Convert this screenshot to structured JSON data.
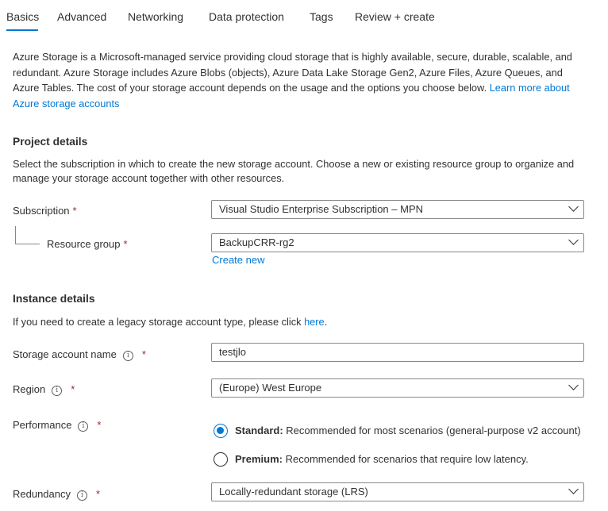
{
  "tabs": [
    {
      "label": "Basics",
      "active": true
    },
    {
      "label": "Advanced",
      "active": false
    },
    {
      "label": "Networking",
      "active": false
    },
    {
      "label": "Data protection",
      "active": false
    },
    {
      "label": "Tags",
      "active": false
    },
    {
      "label": "Review + create",
      "active": false
    }
  ],
  "intro": {
    "text": "Azure Storage is a Microsoft-managed service providing cloud storage that is highly available, secure, durable, scalable, and redundant. Azure Storage includes Azure Blobs (objects), Azure Data Lake Storage Gen2, Azure Files, Azure Queues, and Azure Tables. The cost of your storage account depends on the usage and the options you choose below. ",
    "link": "Learn more about Azure storage accounts"
  },
  "project": {
    "title": "Project details",
    "description": "Select the subscription in which to create the new storage account. Choose a new or existing resource group to organize and manage your storage account together with other resources.",
    "subscription_label": "Subscription",
    "subscription_value": "Visual Studio Enterprise Subscription – MPN",
    "resource_group_label": "Resource group",
    "resource_group_value": "BackupCRR-rg2",
    "create_new": "Create new"
  },
  "instance": {
    "title": "Instance details",
    "description": "If you need to create a legacy storage account type, please click ",
    "description_link": "here",
    "description_end": ".",
    "account_name_label": "Storage account name",
    "account_name_value": "testjlo",
    "region_label": "Region",
    "region_value": "(Europe) West Europe",
    "performance_label": "Performance",
    "standard_title": "Standard:",
    "standard_desc": "Recommended for most scenarios (general-purpose v2 account)",
    "premium_title": "Premium:",
    "premium_desc": "Recommended for scenarios that require low latency.",
    "selected_performance": "Standard",
    "redundancy_label": "Redundancy",
    "redundancy_value": "Locally-redundant storage (LRS)"
  },
  "common": {
    "required_mark": "*",
    "info_glyph": "i"
  },
  "colors": {
    "accent": "#0078d4",
    "required": "#a4262c",
    "text": "#323130"
  }
}
